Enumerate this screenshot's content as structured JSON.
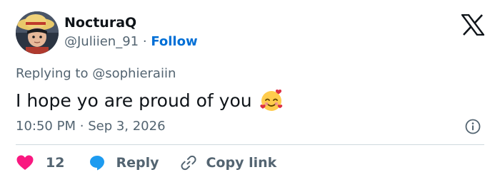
{
  "author": {
    "display_name": "NocturaQ",
    "handle": "@Juliien_91",
    "separator": "·",
    "follow_label": "Follow"
  },
  "reply_context": {
    "prefix": "Replying to",
    "handle": "@sophieraiin"
  },
  "tweet": {
    "text": "I hope yo are proud of you",
    "emoji": "smiling-face-with-hearts"
  },
  "meta": {
    "time": "10:50 PM",
    "separator": "·",
    "date": "Sep 3, 2026"
  },
  "actions": {
    "like_count": "12",
    "reply_label": "Reply",
    "copy_label": "Copy link"
  },
  "colors": {
    "link": "#006fd6",
    "like": "#f91880",
    "reply": "#1d9bf0",
    "secondary_text": "#536471",
    "primary_text": "#0f1419",
    "divider": "#cfd9de"
  },
  "icons": [
    "x-logo-icon",
    "info-icon",
    "heart-icon",
    "reply-bubble-icon",
    "link-icon"
  ]
}
